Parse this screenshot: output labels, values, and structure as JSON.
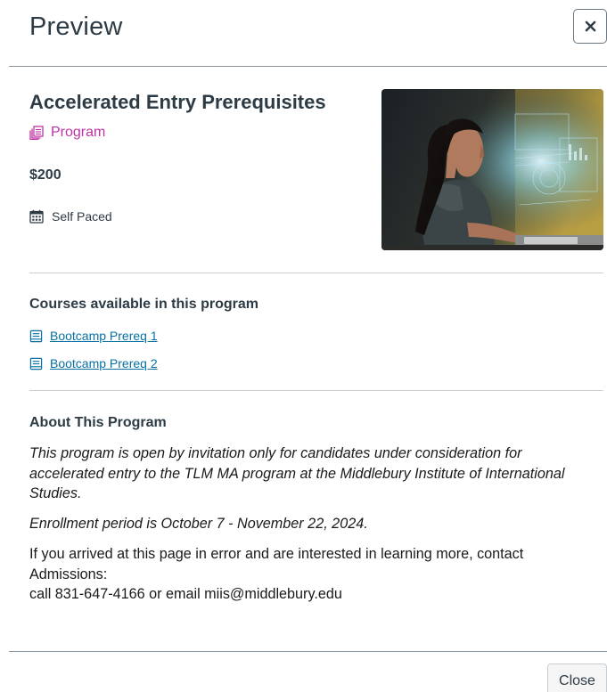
{
  "header": {
    "title": "Preview",
    "close_icon": "close-icon"
  },
  "program": {
    "title": "Accelerated Entry Prerequisites",
    "type_label": "Program",
    "type_icon": "program-icon",
    "price": "$200",
    "pace_label": "Self Paced",
    "pace_icon": "calendar-icon",
    "image_icon": "program-hero-image"
  },
  "courses": {
    "heading": "Courses available in this program",
    "items": [
      {
        "label": "Bootcamp Prereq 1",
        "icon": "course-icon"
      },
      {
        "label": "Bootcamp Prereq 2",
        "icon": "course-icon"
      }
    ]
  },
  "about": {
    "heading": "About This Program",
    "paragraph1": "This program is open by invitation only for candidates under consideration for accelerated entry to the TLM MA program at the Middlebury Institute of International Studies.",
    "paragraph2": "Enrollment period is October 7 - November 22, 2024.",
    "paragraph3_line1": "If you arrived at this page in error and are interested in learning more, contact Admissions:",
    "paragraph3_line2": "call 831-647-4166 or email miis@middlebury.edu"
  },
  "footer": {
    "close_label": "Close"
  },
  "colors": {
    "accent_program": "#bf32a4",
    "link": "#0770a3",
    "text": "#2d3b45"
  }
}
